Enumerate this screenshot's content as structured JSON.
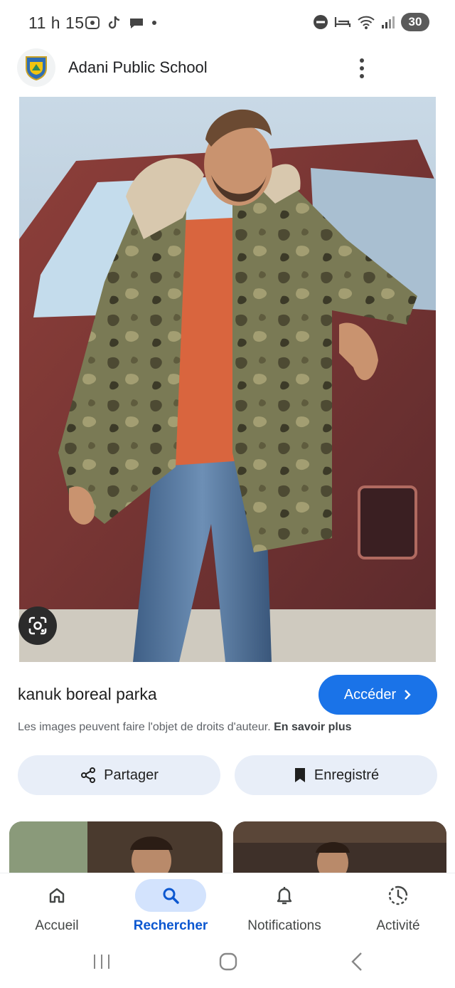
{
  "status": {
    "time": "11 h 15",
    "battery": "30"
  },
  "header": {
    "site_name": "Adani Public School"
  },
  "result": {
    "title": "kanuk boreal parka",
    "visit_label": "Accéder",
    "copyright_text": "Les images peuvent faire l'objet de droits d'auteur.",
    "learn_more": "En savoir plus"
  },
  "actions": {
    "share_label": "Partager",
    "saved_label": "Enregistré"
  },
  "nav": {
    "items": [
      {
        "label": "Accueil",
        "icon": "home-icon"
      },
      {
        "label": "Rechercher",
        "icon": "search-icon"
      },
      {
        "label": "Notifications",
        "icon": "bell-icon"
      },
      {
        "label": "Activité",
        "icon": "activity-icon"
      }
    ],
    "active_index": 1
  },
  "colors": {
    "accent": "#1a73e8",
    "pill_bg": "#e8eef8",
    "nav_active_bg": "#d3e3fd",
    "nav_active_text": "#0b57d0"
  }
}
